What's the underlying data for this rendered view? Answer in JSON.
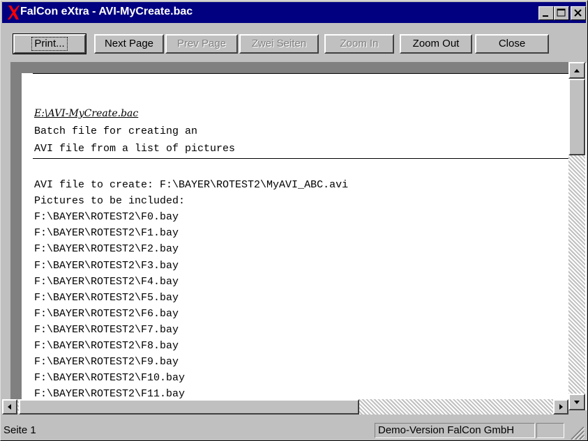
{
  "window": {
    "title": "FalCon eXtra - AVI-MyCreate.bac"
  },
  "toolbar": {
    "print": "Print...",
    "next_page": "Next Page",
    "prev_page": "Prev Page",
    "two_pages": "Zwei Seiten",
    "zoom_in": "Zoom In",
    "zoom_out": "Zoom Out",
    "close": "Close"
  },
  "document": {
    "filename": "E:\\AVI-MyCreate.bac",
    "description_line1": "Batch file for creating an",
    "description_line2": "AVI file from a list of pictures",
    "lines": [
      "AVI file to create: F:\\BAYER\\ROTEST2\\MyAVI_ABC.avi",
      "Pictures to be included:",
      "F:\\BAYER\\ROTEST2\\F0.bay",
      "F:\\BAYER\\ROTEST2\\F1.bay",
      "F:\\BAYER\\ROTEST2\\F2.bay",
      "F:\\BAYER\\ROTEST2\\F3.bay",
      "F:\\BAYER\\ROTEST2\\F4.bay",
      "F:\\BAYER\\ROTEST2\\F5.bay",
      "F:\\BAYER\\ROTEST2\\F6.bay",
      "F:\\BAYER\\ROTEST2\\F7.bay",
      "F:\\BAYER\\ROTEST2\\F8.bay",
      "F:\\BAYER\\ROTEST2\\F9.bay",
      "F:\\BAYER\\ROTEST2\\F10.bay",
      "F:\\BAYER\\ROTEST2\\F11.bay"
    ]
  },
  "status": {
    "page": "Seite 1",
    "license": "Demo-Version FalCon GmbH"
  },
  "colors": {
    "titlebar": "#000080",
    "face": "#c0c0c0",
    "icon": "#ff0000"
  }
}
